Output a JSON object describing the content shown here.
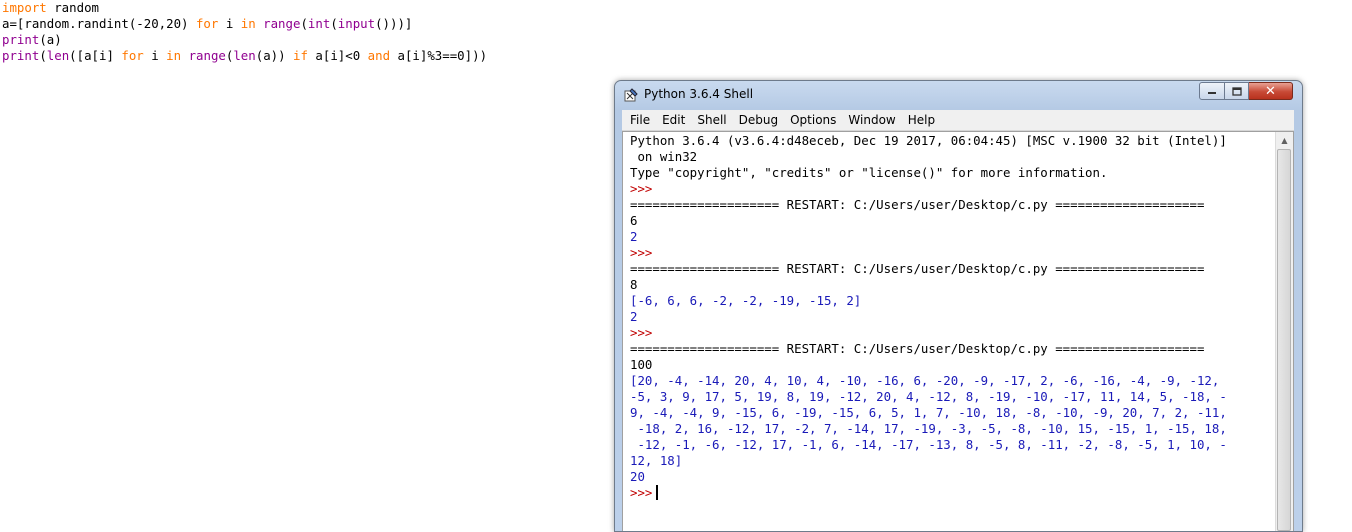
{
  "editor": {
    "lines": [
      {
        "segments": [
          {
            "t": "import",
            "c": "kw"
          },
          {
            "t": " random",
            "c": ""
          }
        ]
      },
      {
        "segments": [
          {
            "t": "a=[random.randint(-20,20) ",
            "c": ""
          },
          {
            "t": "for",
            "c": "kw"
          },
          {
            "t": " i ",
            "c": ""
          },
          {
            "t": "in",
            "c": "kw"
          },
          {
            "t": " ",
            "c": ""
          },
          {
            "t": "range",
            "c": "bi"
          },
          {
            "t": "(",
            "c": ""
          },
          {
            "t": "int",
            "c": "bi"
          },
          {
            "t": "(",
            "c": ""
          },
          {
            "t": "input",
            "c": "bi"
          },
          {
            "t": "()))]",
            "c": ""
          }
        ]
      },
      {
        "segments": [
          {
            "t": "print",
            "c": "bi"
          },
          {
            "t": "(a)",
            "c": ""
          }
        ]
      },
      {
        "segments": [
          {
            "t": "print",
            "c": "bi"
          },
          {
            "t": "(",
            "c": ""
          },
          {
            "t": "len",
            "c": "bi"
          },
          {
            "t": "([a[i] ",
            "c": ""
          },
          {
            "t": "for",
            "c": "kw"
          },
          {
            "t": " i ",
            "c": ""
          },
          {
            "t": "in",
            "c": "kw"
          },
          {
            "t": " ",
            "c": ""
          },
          {
            "t": "range",
            "c": "bi"
          },
          {
            "t": "(",
            "c": ""
          },
          {
            "t": "len",
            "c": "bi"
          },
          {
            "t": "(a)) ",
            "c": ""
          },
          {
            "t": "if",
            "c": "kw"
          },
          {
            "t": " a[i]<0 ",
            "c": ""
          },
          {
            "t": "and",
            "c": "kw"
          },
          {
            "t": " a[i]%3==0]))",
            "c": ""
          }
        ]
      }
    ]
  },
  "window": {
    "title": "Python 3.6.4 Shell",
    "controls": {
      "minimize": "▭",
      "maximize": "□",
      "close": "✕"
    },
    "menu": [
      "File",
      "Edit",
      "Shell",
      "Debug",
      "Options",
      "Window",
      "Help"
    ]
  },
  "shell": {
    "lines": [
      {
        "text": "Python 3.6.4 (v3.6.4:d48eceb, Dec 19 2017, 06:04:45) [MSC v.1900 32 bit (Intel)]",
        "kind": "plain"
      },
      {
        "text": " on win32",
        "kind": "plain"
      },
      {
        "text": "Type \"copyright\", \"credits\" or \"license()\" for more information.",
        "kind": "plain"
      },
      {
        "text": ">>>",
        "kind": "prompt"
      },
      {
        "text": "==================== RESTART: C:/Users/user/Desktop/c.py ====================",
        "kind": "plain"
      },
      {
        "text": "6",
        "kind": "plain"
      },
      {
        "text": "2",
        "kind": "out"
      },
      {
        "text": ">>>",
        "kind": "prompt"
      },
      {
        "text": "==================== RESTART: C:/Users/user/Desktop/c.py ====================",
        "kind": "plain"
      },
      {
        "text": "8",
        "kind": "plain"
      },
      {
        "text": "[-6, 6, 6, -2, -2, -19, -15, 2]",
        "kind": "out"
      },
      {
        "text": "2",
        "kind": "out"
      },
      {
        "text": ">>>",
        "kind": "prompt"
      },
      {
        "text": "==================== RESTART: C:/Users/user/Desktop/c.py ====================",
        "kind": "plain"
      },
      {
        "text": "100",
        "kind": "plain"
      },
      {
        "text": "[20, -4, -14, 20, 4, 10, 4, -10, -16, 6, -20, -9, -17, 2, -6, -16, -4, -9, -12,",
        "kind": "out"
      },
      {
        "text": "-5, 3, 9, 17, 5, 19, 8, 19, -12, 20, 4, -12, 8, -19, -10, -17, 11, 14, 5, -18, -",
        "kind": "out"
      },
      {
        "text": "9, -4, -4, 9, -15, 6, -19, -15, 6, 5, 1, 7, -10, 18, -8, -10, -9, 20, 7, 2, -11,",
        "kind": "out"
      },
      {
        "text": " -18, 2, 16, -12, 17, -2, 7, -14, 17, -19, -3, -5, -8, -10, 15, -15, 1, -15, 18,",
        "kind": "out"
      },
      {
        "text": " -12, -1, -6, -12, 17, -1, 6, -14, -17, -13, 8, -5, 8, -11, -2, -8, -5, 1, 10, -",
        "kind": "out"
      },
      {
        "text": "12, 18]",
        "kind": "out"
      },
      {
        "text": "20",
        "kind": "out"
      },
      {
        "text": ">>>",
        "kind": "prompt-cursor"
      }
    ]
  },
  "colors": {
    "keyword": "#ff7700",
    "builtin": "#900090",
    "prompt": "#c00000",
    "stdout": "#1a1ab8",
    "close_button": "#c84a36"
  }
}
